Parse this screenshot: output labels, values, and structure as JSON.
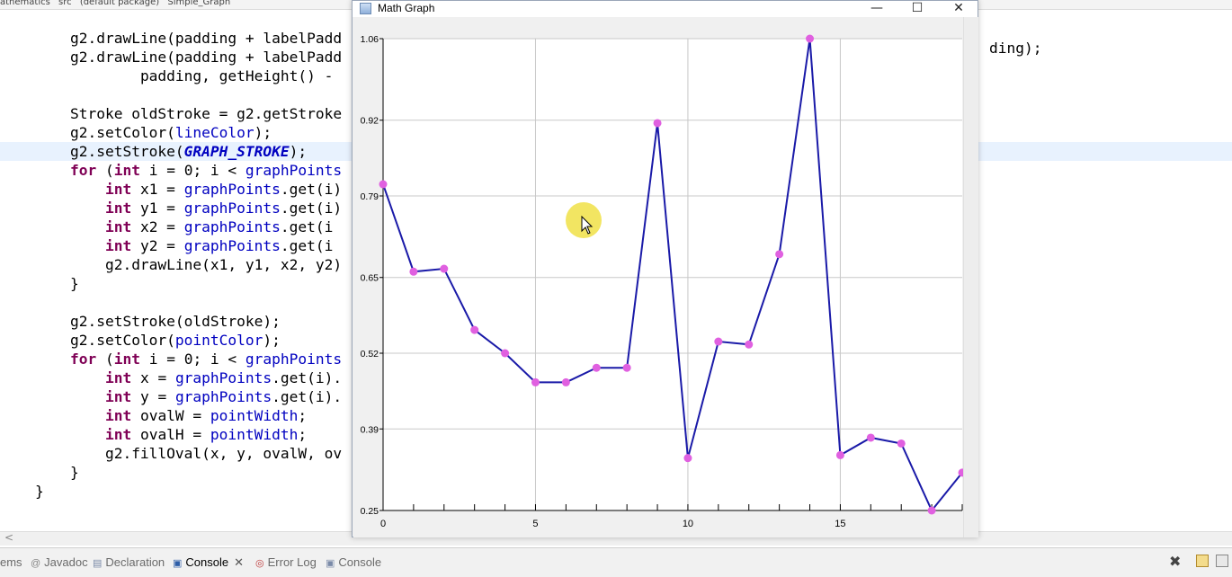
{
  "breadcrumb": [
    "athematics",
    "src",
    "(default package)",
    "Simple_Graph"
  ],
  "code": [
    {
      "indent": "        ",
      "parts": [
        [
          "t",
          "g2.drawLine(padding + labelPadd"
        ]
      ]
    },
    {
      "indent": "        ",
      "parts": [
        [
          "t",
          "g2.drawLine(padding + labelPadd"
        ]
      ]
    },
    {
      "indent": "                ",
      "parts": [
        [
          "t",
          "padding, getHeight() -"
        ]
      ]
    },
    {
      "indent": "",
      "parts": [
        [
          "t",
          ""
        ]
      ]
    },
    {
      "indent": "        ",
      "parts": [
        [
          "t",
          "Stroke oldStroke = g2.getStroke"
        ]
      ]
    },
    {
      "indent": "        ",
      "parts": [
        [
          "t",
          "g2.setColor("
        ],
        [
          "f",
          "lineColor"
        ],
        [
          "t",
          ");"
        ]
      ]
    },
    {
      "indent": "        ",
      "parts": [
        [
          "t",
          "g2.setStroke("
        ],
        [
          "s",
          "GRAPH_STROKE"
        ],
        [
          "t",
          ");"
        ]
      ],
      "highlight": true
    },
    {
      "indent": "        ",
      "parts": [
        [
          "k",
          "for"
        ],
        [
          "t",
          " ("
        ],
        [
          "k",
          "int"
        ],
        [
          "t",
          " i = 0; i < "
        ],
        [
          "f",
          "graphPoints"
        ]
      ]
    },
    {
      "indent": "            ",
      "parts": [
        [
          "k",
          "int"
        ],
        [
          "t",
          " x1 = "
        ],
        [
          "f",
          "graphPoints"
        ],
        [
          "t",
          ".get(i)"
        ]
      ]
    },
    {
      "indent": "            ",
      "parts": [
        [
          "k",
          "int"
        ],
        [
          "t",
          " y1 = "
        ],
        [
          "f",
          "graphPoints"
        ],
        [
          "t",
          ".get(i)"
        ]
      ]
    },
    {
      "indent": "            ",
      "parts": [
        [
          "k",
          "int"
        ],
        [
          "t",
          " x2 = "
        ],
        [
          "f",
          "graphPoints"
        ],
        [
          "t",
          ".get(i"
        ]
      ]
    },
    {
      "indent": "            ",
      "parts": [
        [
          "k",
          "int"
        ],
        [
          "t",
          " y2 = "
        ],
        [
          "f",
          "graphPoints"
        ],
        [
          "t",
          ".get(i"
        ]
      ]
    },
    {
      "indent": "            ",
      "parts": [
        [
          "t",
          "g2.drawLine(x1, y1, x2, y2)"
        ]
      ]
    },
    {
      "indent": "        ",
      "parts": [
        [
          "t",
          "}"
        ]
      ]
    },
    {
      "indent": "",
      "parts": [
        [
          "t",
          ""
        ]
      ]
    },
    {
      "indent": "        ",
      "parts": [
        [
          "t",
          "g2.setStroke(oldStroke);"
        ]
      ]
    },
    {
      "indent": "        ",
      "parts": [
        [
          "t",
          "g2.setColor("
        ],
        [
          "f",
          "pointColor"
        ],
        [
          "t",
          ");"
        ]
      ]
    },
    {
      "indent": "        ",
      "parts": [
        [
          "k",
          "for"
        ],
        [
          "t",
          " ("
        ],
        [
          "k",
          "int"
        ],
        [
          "t",
          " i = 0; i < "
        ],
        [
          "f",
          "graphPoints"
        ]
      ]
    },
    {
      "indent": "            ",
      "parts": [
        [
          "k",
          "int"
        ],
        [
          "t",
          " x = "
        ],
        [
          "f",
          "graphPoints"
        ],
        [
          "t",
          ".get(i)."
        ]
      ]
    },
    {
      "indent": "            ",
      "parts": [
        [
          "k",
          "int"
        ],
        [
          "t",
          " y = "
        ],
        [
          "f",
          "graphPoints"
        ],
        [
          "t",
          ".get(i)."
        ]
      ]
    },
    {
      "indent": "            ",
      "parts": [
        [
          "k",
          "int"
        ],
        [
          "t",
          " ovalW = "
        ],
        [
          "f",
          "pointWidth"
        ],
        [
          "t",
          ";"
        ]
      ]
    },
    {
      "indent": "            ",
      "parts": [
        [
          "k",
          "int"
        ],
        [
          "t",
          " ovalH = "
        ],
        [
          "f",
          "pointWidth"
        ],
        [
          "t",
          ";"
        ]
      ]
    },
    {
      "indent": "            ",
      "parts": [
        [
          "t",
          "g2.fillOval(x, y, ovalW, ov"
        ]
      ]
    },
    {
      "indent": "        ",
      "parts": [
        [
          "t",
          "}"
        ]
      ]
    },
    {
      "indent": "    ",
      "parts": [
        [
          "t",
          "}"
        ]
      ]
    }
  ],
  "right_fragment": "ding);",
  "scroll_arrow": "<",
  "window": {
    "title": "Math Graph",
    "minimize": "—",
    "maximize": "☐",
    "close": "✕"
  },
  "bottom_tabs": [
    {
      "label": "ems",
      "icon": "problems-icon",
      "active": false
    },
    {
      "label": "Javadoc",
      "icon": "javadoc-icon",
      "active": false
    },
    {
      "label": "Declaration",
      "icon": "declaration-icon",
      "active": false
    },
    {
      "label": "Console",
      "icon": "console-icon",
      "active": true
    },
    {
      "label": "Error Log",
      "icon": "error-log-icon",
      "active": false
    },
    {
      "label": "Console",
      "icon": "console-icon",
      "active": false
    }
  ],
  "chart_data": {
    "type": "line",
    "x": [
      0,
      1,
      2,
      3,
      4,
      5,
      6,
      7,
      8,
      9,
      10,
      11,
      12,
      13,
      14,
      15,
      16,
      17,
      18,
      19
    ],
    "y": [
      0.81,
      0.66,
      0.665,
      0.56,
      0.52,
      0.47,
      0.47,
      0.495,
      0.495,
      0.915,
      0.34,
      0.54,
      0.535,
      0.69,
      1.06,
      0.345,
      0.375,
      0.365,
      0.25,
      0.315
    ],
    "y_tick_labels": [
      "0.25",
      "0.39",
      "0.52",
      "0.65",
      "0.79",
      "0.92",
      "1.06"
    ],
    "x_tick_labels": [
      "0",
      "5",
      "10",
      "15"
    ],
    "ylim": [
      0.25,
      1.06
    ],
    "xlim": [
      0,
      19
    ],
    "grid": true,
    "line_color": "#1a1aa8",
    "point_color": "#e060e0",
    "title": "",
    "xlabel": "",
    "ylabel": ""
  }
}
